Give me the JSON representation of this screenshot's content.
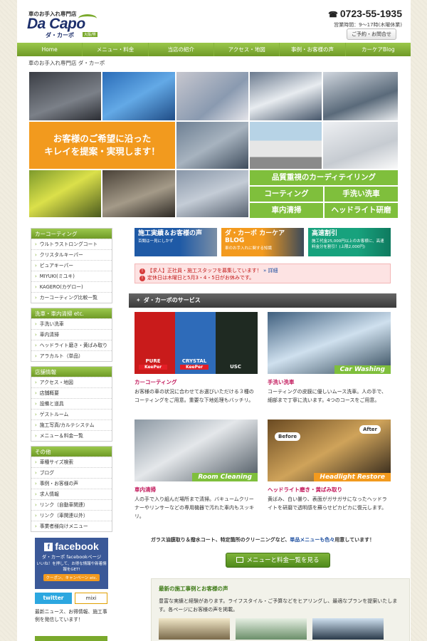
{
  "header": {
    "tagline": "車のお手入れ専門店",
    "logo_text": "Da Capo",
    "logo_sub": "ダ・カーポ",
    "logo_badge": "大阪/堺",
    "phone": "0723-55-1935",
    "hours": "営業時間：9〜17時(木曜休業)",
    "contact_button": "ご予約・お問合せ"
  },
  "nav": {
    "items": [
      "Home",
      "メニュー・料金",
      "当店の紹介",
      "アクセス・地図",
      "事例・お客様の声",
      "カーケアBlog"
    ]
  },
  "breadcrumb": "車のお手入れ専門店 ダ・カーポ",
  "hero": {
    "orange_line1": "お客様のご希望に沿った",
    "orange_line2": "キレイを提案・実現します！",
    "green_main": "品質重視のカーディテイリング",
    "green_items": [
      "コーティング",
      "手洗い洗車",
      "車内清掃",
      "ヘッドライト研磨"
    ]
  },
  "sidebar": {
    "groups": [
      {
        "title": "カーコーティング",
        "items": [
          "ウルトラストロングコート",
          "クリスタルキーパー",
          "ピュアキーパー",
          "MIYUKI(ミユキ)",
          "KAGERO(カゲロー)",
          "カーコーティング比較一覧"
        ]
      },
      {
        "title": "洗車・車内清掃 etc.",
        "items": [
          "手洗い洗車",
          "車内清掃",
          "ヘッドライト磨き・黄ばみ取り",
          "アラカルト（単品）"
        ]
      },
      {
        "title": "店舗情報",
        "items": [
          "アクセス・地図",
          "店舗概要",
          "設備と道具",
          "ゲストルーム",
          "施工写真/カルテシステム",
          "メニュー＆料金一覧"
        ]
      },
      {
        "title": "その他",
        "items": [
          "車種サイズ検索",
          "ブログ",
          "事例・お客様の声",
          "求人情報",
          "リンク（自動車関連）",
          "リンク（車関連以外）",
          "事業者様向けメニュー"
        ]
      }
    ],
    "facebook": {
      "title": "facebook",
      "sub": "ダ・カーポ facebookページ",
      "like_text": "いいね！を押して、お得な情報や新着情報をGET!",
      "coupon": "クーポン、キャンペーン etc."
    },
    "twitter": "twitter",
    "mixi": "mixi",
    "news": "最新ニュース、お得情報、施工事例を発信しています！"
  },
  "banners": [
    {
      "title": "施工実績＆お客様の声",
      "sub": "百聞は一見にしかず"
    },
    {
      "title": "ダ・カーポ カーケアBLOG",
      "sub": "車のお手入れに関する知識"
    },
    {
      "title": "高速割引",
      "sub": "施工代金25,000円以上のお客様に、高速料金分を割引！(上限2,000円)"
    }
  ],
  "notice": {
    "recruit": "【求人】正社員・施工スタッフを募集しています！",
    "recruit_more": "» 詳細",
    "holiday": "定休日は木曜日と5月3・4・5日がお休みです。"
  },
  "services": {
    "heading": "ダ・カーポのサービス",
    "items": [
      {
        "name": "カーコーティング",
        "desc": "お客様の車の状況に合わせてお選びいただける３種のコーティングをご用意。重要な下地処理もバッチリ。",
        "caption": ""
      },
      {
        "name": "手洗い洗車",
        "desc": "コーティングの皮膜に優しいムース洗車。人の手で、細部まで丁寧に洗います。4つのコースをご用意。",
        "caption": "Car Washing"
      },
      {
        "name": "車内清掃",
        "desc": "人の手で入り組んだ場所まで清掃。バキュームクリーナーやリンサーなどの専用機器で汚れた車内もスッキリ。",
        "caption": "Room Cleaning"
      },
      {
        "name": "ヘッドライト磨き・黄ばみ取り",
        "desc": "黄ばみ、白い曇り、表面がガサガサになったヘッドライトを研磨で透明感を蘇らせピカピカに復元します。",
        "caption": "Headlight Restore"
      }
    ],
    "keeper_labels": [
      "PURE",
      "CRYSTAL",
      "USC"
    ],
    "keeper_brand": "KeePer",
    "before": "Before",
    "after": "After"
  },
  "closing": {
    "text": "ガラス油膜取り＆撥水コート、特定箇所のクリーニングなど、",
    "highlight": "単品メニューも色々",
    "tail": "用意しています！"
  },
  "menu_button": "メニューと料金一覧を見る",
  "cases": {
    "title": "最新の施工事例とお客様の声",
    "desc": "豊富な実績と経験があります。ライフスタイル・ご予算などをヒアリングし、最適なプランを提案いたします。各ページにお客様の声を掲載。"
  },
  "colors": {
    "accent_green": "#7aa92c",
    "accent_orange": "#f29a1e",
    "service_title": "#c2185b",
    "notice_red": "#c21818"
  }
}
